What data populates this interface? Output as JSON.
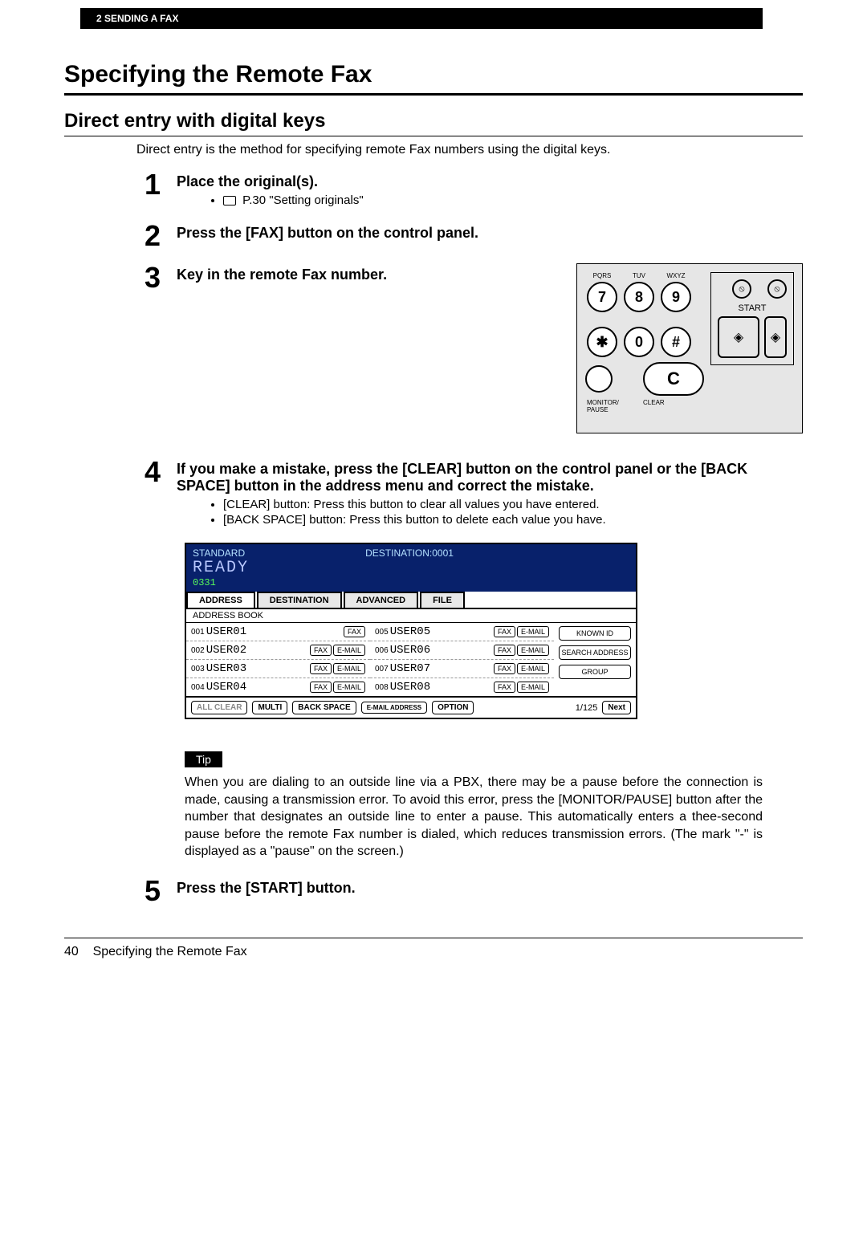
{
  "header_bar": "2   SENDING A FAX",
  "h1": "Specifying the Remote Fax",
  "h2": "Direct entry with digital keys",
  "intro": "Direct entry is the method for specifying remote Fax numbers using the digital keys.",
  "steps": {
    "s1": {
      "num": "1",
      "title": "Place the original(s).",
      "ref": "P.30 \"Setting originals\""
    },
    "s2": {
      "num": "2",
      "title": "Press the [FAX] button on the control panel."
    },
    "s3": {
      "num": "3",
      "title": "Key in the remote Fax number."
    },
    "s4": {
      "num": "4",
      "title": "If you make a mistake, press the [CLEAR] button on the control panel or the [BACK SPACE] button in the address menu and correct the mistake.",
      "b1": "[CLEAR] button: Press this button to clear all values you have entered.",
      "b2": "[BACK SPACE] button: Press this button to delete each value you have."
    },
    "s5": {
      "num": "5",
      "title": "Press the [START] button."
    }
  },
  "keypad": {
    "labels": {
      "pqrs": "PQRS",
      "tuv": "TUV",
      "wxyz": "WXYZ"
    },
    "k7": "7",
    "k8": "8",
    "k9": "9",
    "kstar": "✱",
    "k0": "0",
    "khash": "#",
    "c": "C",
    "monitor_pause": "MONITOR/\nPAUSE",
    "clear": "CLEAR",
    "start": "START",
    "stop_icon": "⦸",
    "diamond": "◈"
  },
  "screen": {
    "standard": "STANDARD",
    "destination": "DESTINATION:0001",
    "ready": "READY",
    "number": "0331",
    "tabs": {
      "address": "ADDRESS",
      "destination_tab": "DESTINATION",
      "advanced": "ADVANCED",
      "file": "FILE"
    },
    "subhead": "ADDRESS BOOK",
    "users": [
      {
        "id": "001",
        "name": "USER01",
        "fax": true,
        "email": false
      },
      {
        "id": "002",
        "name": "USER02",
        "fax": true,
        "email": true
      },
      {
        "id": "003",
        "name": "USER03",
        "fax": true,
        "email": true
      },
      {
        "id": "004",
        "name": "USER04",
        "fax": true,
        "email": true
      },
      {
        "id": "005",
        "name": "USER05",
        "fax": true,
        "email": true
      },
      {
        "id": "006",
        "name": "USER06",
        "fax": true,
        "email": true
      },
      {
        "id": "007",
        "name": "USER07",
        "fax": true,
        "email": true
      },
      {
        "id": "008",
        "name": "USER08",
        "fax": true,
        "email": true
      }
    ],
    "side": {
      "known_id": "KNOWN ID",
      "search_address": "SEARCH ADDRESS",
      "group": "GROUP"
    },
    "fax_lbl": "FAX",
    "email_lbl": "E-MAIL",
    "footer": {
      "all_clear": "ALL CLEAR",
      "multi": "MULTI",
      "back_space": "BACK SPACE",
      "mail_address": "E-MAIL ADDRESS",
      "option": "OPTION",
      "page": "1/125",
      "next": "Next"
    }
  },
  "tip_label": "Tip",
  "tip_text": "When you are dialing to an outside line via a PBX, there may be a pause before the connection is made, causing a transmission error. To avoid this error, press the [MONITOR/PAUSE] button after the number that designates an outside line to enter a pause. This automatically enters a thee-second pause before the remote Fax number is dialed, which reduces transmission errors. (The mark \"-\" is displayed as a \"pause\" on the screen.)",
  "footer_page": "40",
  "footer_text": "Specifying the Remote Fax"
}
